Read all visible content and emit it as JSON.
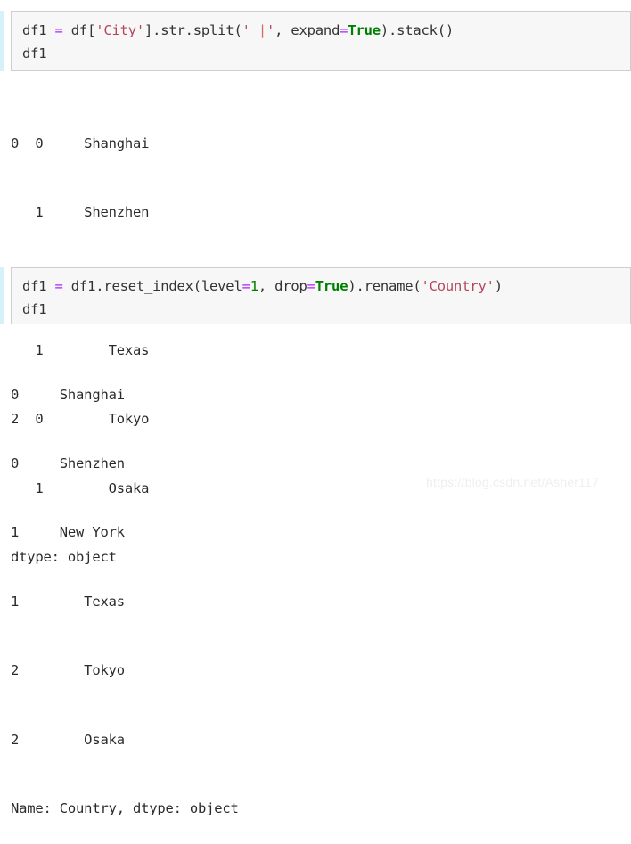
{
  "cells": [
    {
      "id": "cell-1",
      "prompt_marker": "in-prompt-bar",
      "code_lines": [
        {
          "tokens": [
            {
              "t": "df1 ",
              "k": "plain"
            },
            {
              "t": "=",
              "k": "op"
            },
            {
              "t": " df[",
              "k": "plain"
            },
            {
              "t": "'City'",
              "k": "str"
            },
            {
              "t": "].str.split(",
              "k": "plain"
            },
            {
              "t": "' ",
              "k": "str"
            },
            {
              "t": "|",
              "k": "pipe"
            },
            {
              "t": "'",
              "k": "str"
            },
            {
              "t": ", expand",
              "k": "plain"
            },
            {
              "t": "=",
              "k": "op"
            },
            {
              "t": "True",
              "k": "kw"
            },
            {
              "t": ").stack()",
              "k": "plain"
            }
          ]
        },
        {
          "tokens": [
            {
              "t": "df1",
              "k": "plain"
            }
          ]
        }
      ],
      "output_lines": [
        "0  0     Shanghai",
        "   1     Shenzhen",
        "1  0     New York",
        "   1        Texas",
        "2  0        Tokyo",
        "   1        Osaka",
        "dtype: object"
      ]
    },
    {
      "id": "cell-2",
      "prompt_marker": "in-prompt-bar",
      "code_lines": [
        {
          "tokens": [
            {
              "t": "df1 ",
              "k": "plain"
            },
            {
              "t": "=",
              "k": "op"
            },
            {
              "t": " df1.reset_index(level",
              "k": "plain"
            },
            {
              "t": "=",
              "k": "op"
            },
            {
              "t": "1",
              "k": "num"
            },
            {
              "t": ", drop",
              "k": "plain"
            },
            {
              "t": "=",
              "k": "op"
            },
            {
              "t": "True",
              "k": "kw"
            },
            {
              "t": ").rename(",
              "k": "plain"
            },
            {
              "t": "'Country'",
              "k": "str"
            },
            {
              "t": ")",
              "k": "plain"
            }
          ]
        },
        {
          "tokens": [
            {
              "t": "df1",
              "k": "plain"
            }
          ]
        }
      ],
      "output_lines": [
        "0     Shanghai",
        "0     Shenzhen",
        "1     New York",
        "1        Texas",
        "2        Tokyo",
        "2        Osaka",
        "Name: Country, dtype: object"
      ]
    }
  ],
  "watermark": {
    "text": "https://blog.csdn.net/Asher117"
  }
}
